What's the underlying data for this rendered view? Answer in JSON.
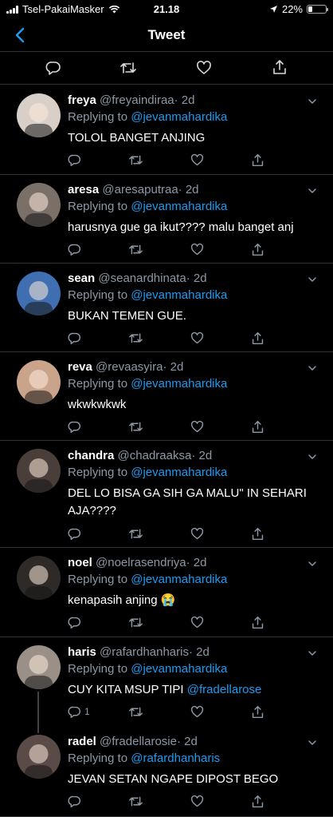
{
  "status": {
    "carrier": "Tsel-PakaiMasker",
    "time": "21.18",
    "battery": "22%",
    "battery_level": 0.22
  },
  "nav": {
    "title": "Tweet"
  },
  "tweets": [
    {
      "name": "freya",
      "handle": "@freyaindiraa",
      "time": "· 2d",
      "reply_prefix": "Replying to",
      "reply_to": "@jevanmahardika",
      "text": "TOLOL BANGET ANJING",
      "avatar_color": "#d8cfc8"
    },
    {
      "name": "aresa",
      "handle": "@aresaputraa",
      "time": "· 2d",
      "reply_prefix": "Replying to",
      "reply_to": "@jevanmahardika",
      "text": "harusnya gue ga ikut???? malu banget anj",
      "avatar_color": "#7a7068"
    },
    {
      "name": "sean",
      "handle": "@seanardhinata",
      "time": "· 2d",
      "reply_prefix": "Replying to",
      "reply_to": "@jevanmahardika",
      "text": "BUKAN TEMEN GUE.",
      "avatar_color": "#3f6fb0"
    },
    {
      "name": "reva",
      "handle": "@revaasyira",
      "time": "· 2d",
      "reply_prefix": "Replying to",
      "reply_to": "@jevanmahardika",
      "text": "wkwkwkwk",
      "avatar_color": "#c9a38a"
    },
    {
      "name": "chandra",
      "handle": "@chadraaksa",
      "time": "· 2d",
      "reply_prefix": "Replying to",
      "reply_to": "@jevanmahardika",
      "text": "DEL LO BISA GA SIH GA MALU\" IN SEHARI AJA????",
      "avatar_color": "#4a3e3a"
    },
    {
      "name": "noel",
      "handle": "@noelrasendriya",
      "time": "· 2d",
      "reply_prefix": "Replying to",
      "reply_to": "@jevanmahardika",
      "text": "kenapasih anjing 😭",
      "avatar_color": "#2e2a28"
    },
    {
      "name": "haris",
      "handle": "@rafardhanharis",
      "time": "· 2d",
      "reply_prefix": "Replying to",
      "reply_to": "@jevanmahardika",
      "text_main": "CUY KITA MSUP TIPI ",
      "text_mention": "@fradellarose",
      "reply_count": "1",
      "avatar_color": "#9a9088"
    },
    {
      "name": "radel",
      "handle": "@fradellarosie",
      "time": "· 2d",
      "reply_prefix": "Replying to",
      "reply_to": "@rafardhanharis",
      "text": "JEVAN SETAN NGAPE DIPOST BEGO",
      "avatar_color": "#5a4a48"
    }
  ]
}
